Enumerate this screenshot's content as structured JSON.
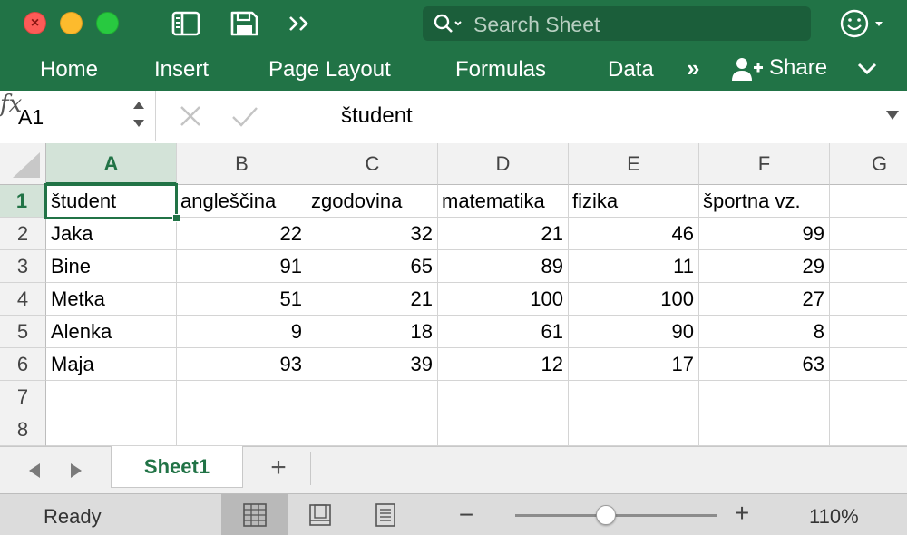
{
  "window": {
    "buttons": [
      "close",
      "minimize",
      "zoom"
    ]
  },
  "quick_access": {
    "icons": [
      "sidebar-icon",
      "save-icon",
      "more-chevrons-icon"
    ]
  },
  "search": {
    "placeholder": "Search Sheet"
  },
  "ribbon": {
    "tabs": [
      "Home",
      "Insert",
      "Page Layout",
      "Formulas",
      "Data"
    ],
    "more_label": "»",
    "share_label": "Share"
  },
  "formula_bar": {
    "name_box": "A1",
    "fx_label": "fx",
    "content": "študent"
  },
  "sheet": {
    "column_headers": [
      "A",
      "B",
      "C",
      "D",
      "E",
      "F",
      "G"
    ],
    "row_headers": [
      "1",
      "2",
      "3",
      "4",
      "5",
      "6",
      "7",
      "8"
    ],
    "selected_cell": "A1",
    "rows": [
      [
        "študent",
        "angleščina",
        "zgodovina",
        "matematika",
        "fizika",
        "športna vz."
      ],
      [
        "Jaka",
        "22",
        "32",
        "21",
        "46",
        "99"
      ],
      [
        "Bine",
        "91",
        "65",
        "89",
        "11",
        "29"
      ],
      [
        "Metka",
        "51",
        "21",
        "100",
        "100",
        "27"
      ],
      [
        "Alenka",
        "9",
        "18",
        "61",
        "90",
        "8"
      ],
      [
        "Maja",
        "93",
        "39",
        "12",
        "17",
        "63"
      ],
      [
        "",
        "",
        "",
        "",
        "",
        ""
      ],
      [
        "",
        "",
        "",
        "",
        "",
        ""
      ]
    ]
  },
  "sheet_tabs": {
    "active": "Sheet1",
    "add_label": "+"
  },
  "status_bar": {
    "status": "Ready",
    "view_mode": "normal",
    "zoom_minus": "−",
    "zoom_plus": "+",
    "zoom": "110%",
    "zoom_level_fraction": 0.45
  },
  "colors": {
    "accent": "#217346",
    "header_bg": "#f2f2f2",
    "status_bg": "#dcdcdc"
  }
}
